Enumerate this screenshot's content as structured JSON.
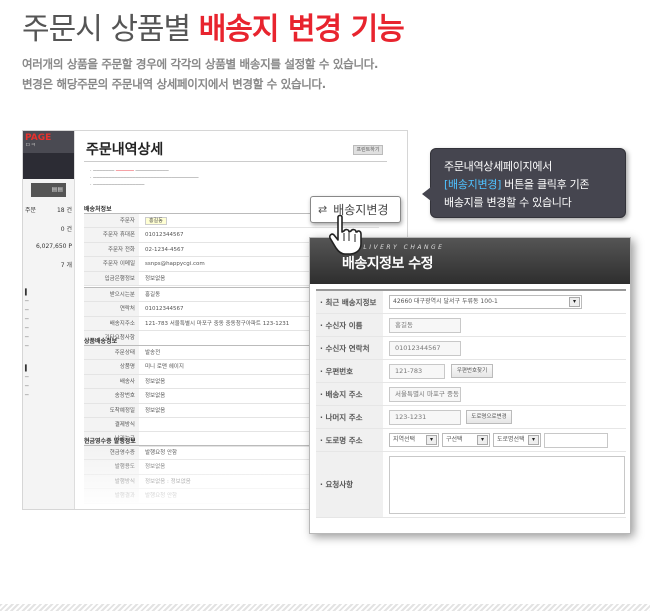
{
  "header": {
    "title_plain": "주문시 상품별",
    "title_accent": "배송지 변경 기능",
    "desc_line1": "여러개의 상품을 주문할 경우에 각각의 상품별 배송지를 설정할 수 있습니다.",
    "desc_line2": "변경은 해당주문의 주문내역 상세페이지에서 변경할 수 있습니다."
  },
  "callout": {
    "line1": "주문내역상세페이지에서",
    "line2_highlight": "[배송지변경]",
    "line2_rest": " 버튼을 클릭후 기존",
    "line3": "배송지를 변경할 수 있습니다"
  },
  "address_change_button": {
    "label": "배송지변경"
  },
  "shop": {
    "logo": "PAGE",
    "logo_sub": "ㅁㅋ",
    "page_title": "주문내역상세",
    "print_button": "프린트하기",
    "section_delivery_info": "배송처정보",
    "section_item_delivery": "상품배송정보",
    "section_receipt": "현금영수증 발행정보",
    "sidebar_stats": [
      {
        "label": "주문",
        "value": "18 건"
      },
      {
        "label": "",
        "value": "0 건"
      },
      {
        "label": "",
        "value": "6,027,650 P"
      },
      {
        "label": "",
        "value": "7 개"
      }
    ],
    "order_rows": [
      {
        "key": "주문자",
        "value": "홍길동"
      },
      {
        "key": "주문자 휴대폰",
        "value": "01012344567"
      },
      {
        "key": "주문자 전화",
        "value": "02-1234-4567"
      },
      {
        "key": "주문자 이메일",
        "value": "ssnps@happycgi.com"
      },
      {
        "key": "입금은행정보",
        "value": "정보없음"
      }
    ],
    "receiver_rows": [
      {
        "key": "받으시는분",
        "value": "홍길동"
      },
      {
        "key": "연락처",
        "value": "01012344567"
      },
      {
        "key": "배송지주소",
        "value": "121-783 서울특별시 마포구 중동 중동청구아파트 123-1231"
      },
      {
        "key": "기타요청사항",
        "value": ""
      }
    ],
    "item_rows": [
      {
        "key": "주문상태",
        "value": "발송전"
      },
      {
        "key": "상품명",
        "value": "미니 로맨 헤이지"
      },
      {
        "key": "배송사",
        "value": "정보없음"
      },
      {
        "key": "송장번호",
        "value": "정보없음"
      },
      {
        "key": "도착예정일",
        "value": "정보없음"
      },
      {
        "key": "결제방식",
        "value": ""
      },
      {
        "key": "남기는글",
        "value": ""
      }
    ],
    "receipt_rows": [
      {
        "key": "현금영수증",
        "value": "발행요청 안함"
      },
      {
        "key": "발행용도",
        "value": "정보없음"
      },
      {
        "key": "발행방식",
        "value": "정보없음 : 정보없음"
      },
      {
        "key": "발행결과",
        "value": "발행요청 안함"
      }
    ]
  },
  "modal": {
    "title_en": "DELIVERY CHANGE",
    "title_ko": "배송지정보 수정",
    "recent_address_label": "· 최근 배송지정보",
    "recent_address_value": "42660 대구광역시 달서구 두류동 100-1",
    "name_label": "· 수신자 이름",
    "name_value": "홍길동",
    "phone_label": "· 수신자 연락처",
    "phone_value": "01012344567",
    "zip_label": "· 우편번호",
    "zip_value": "121-783",
    "zip_button": "우편번호찾기",
    "address_label": "· 배송지 주소",
    "address_value": "서울특별시 마포구 중동",
    "detail_label": "· 나머지 주소",
    "detail_value": "123-1231",
    "road_button": "도로명으로변경",
    "road_label": "· 도로명 주소",
    "road_region": "지역선택",
    "road_district": "구선택",
    "road_name": "도로명선택",
    "memo_label": "· 요청사항"
  }
}
